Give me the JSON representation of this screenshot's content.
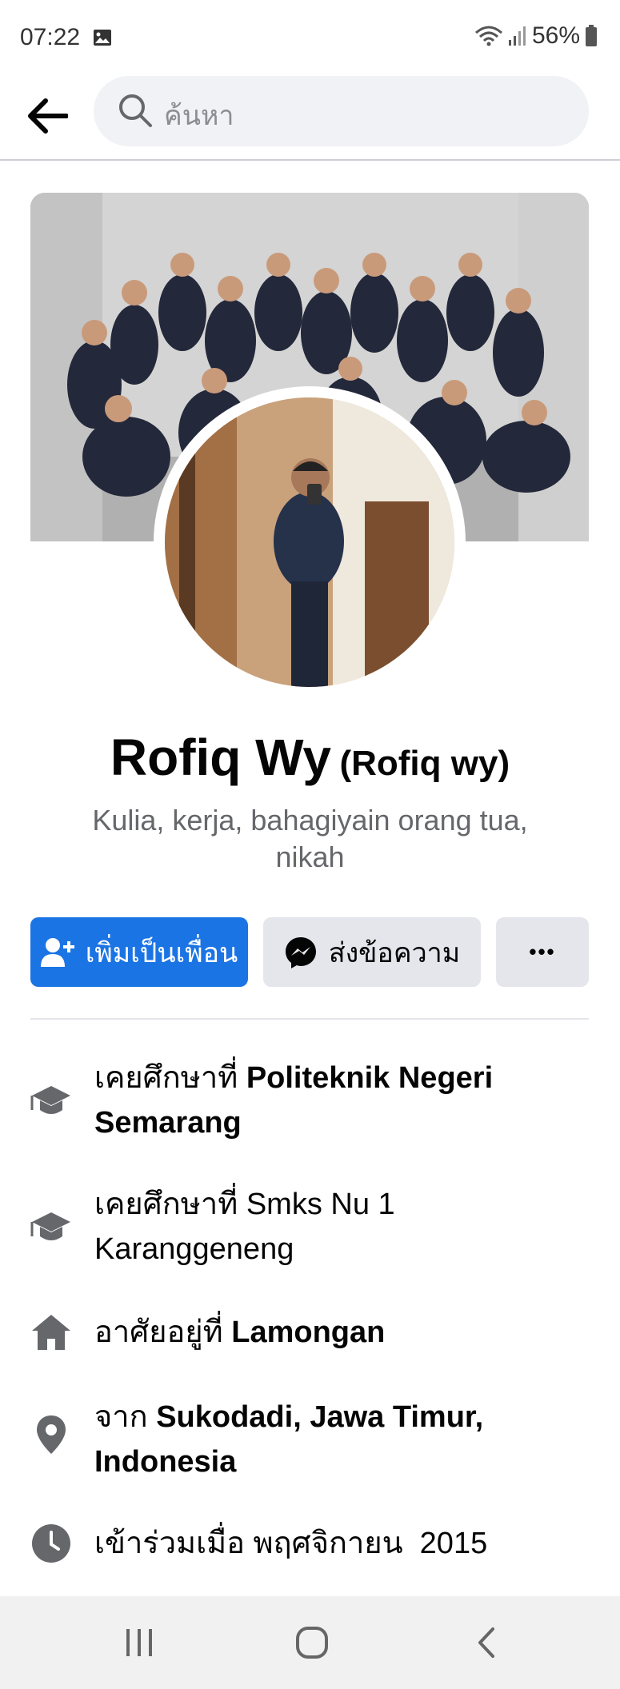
{
  "status_bar": {
    "time": "07:22",
    "battery": "56%",
    "icons": [
      "gallery-icon",
      "wifi-icon",
      "signal-icon",
      "battery-icon"
    ]
  },
  "header": {
    "back_icon": "arrow-left-icon",
    "search_placeholder": "ค้นหา",
    "search_icon": "search-icon"
  },
  "profile": {
    "name": "Rofiq Wy",
    "alternate_name": "(Rofiq wy)",
    "bio": "Kulia, kerja, bahagiyain orang tua, nikah"
  },
  "actions": {
    "add_friend_label": "เพิ่มเป็นเพื่อน",
    "message_label": "ส่งข้อความ",
    "more_label": "•••"
  },
  "details": [
    {
      "icon": "graduation-cap-icon",
      "prefix": "เคยศึกษาที่",
      "value": "Politeknik Negeri Semarang",
      "bold": true
    },
    {
      "icon": "graduation-cap-icon",
      "prefix": "เคยศึกษาที่",
      "value": "Smks Nu 1 Karanggeneng",
      "bold": false
    },
    {
      "icon": "home-icon",
      "prefix": "อาศัยอยู่ที่",
      "value": "Lamongan",
      "bold": true
    },
    {
      "icon": "location-pin-icon",
      "prefix": "จาก",
      "value": "Sukodadi, Jawa Timur, Indonesia",
      "bold": true
    },
    {
      "icon": "clock-icon",
      "prefix": "เข้าร่วมเมื่อ",
      "value": "พฤศจิกายน  2015",
      "bold": false
    }
  ],
  "colors": {
    "accent": "#1b74e4",
    "secondary_button": "#e4e6eb",
    "muted_text": "#65676b",
    "icon_gray": "#65676b"
  }
}
